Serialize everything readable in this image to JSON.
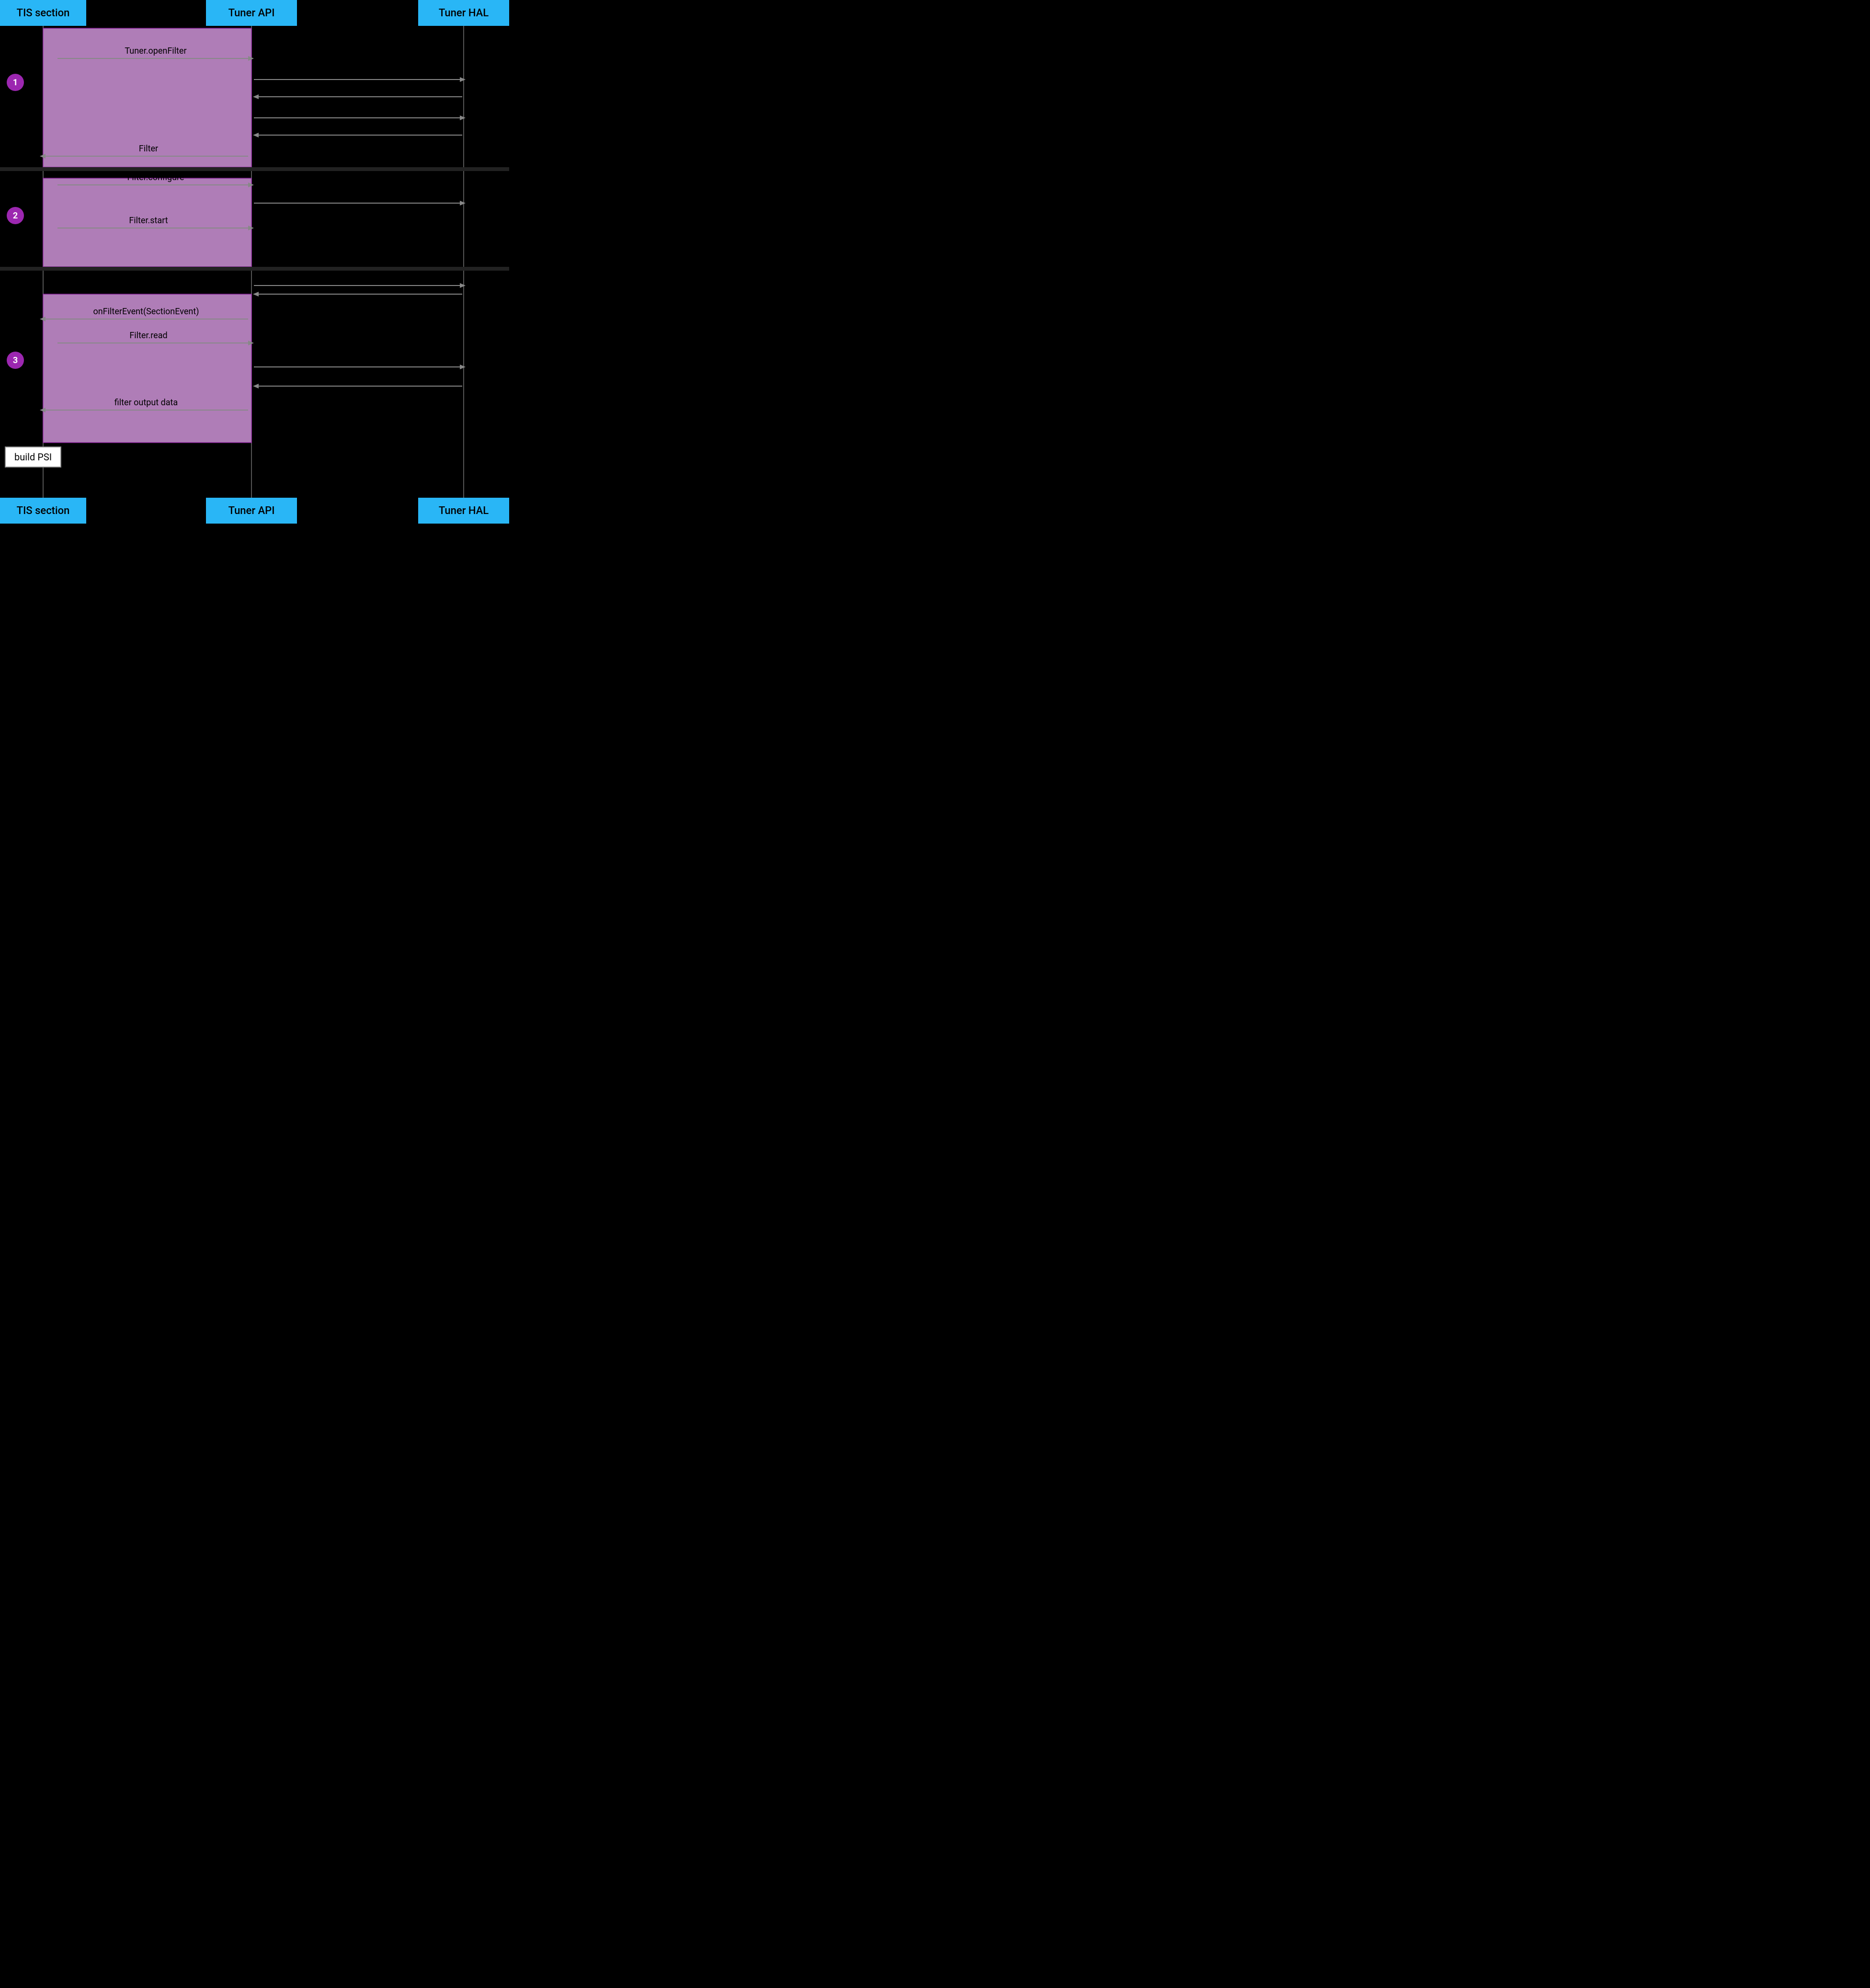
{
  "header": {
    "tis_label": "TIS section",
    "tuner_api_label": "Tuner API",
    "tuner_hal_label": "Tuner HAL"
  },
  "footer": {
    "tis_label": "TIS section",
    "tuner_api_label": "Tuner API",
    "tuner_hal_label": "Tuner HAL"
  },
  "steps": [
    {
      "number": "1"
    },
    {
      "number": "2"
    },
    {
      "number": "3"
    }
  ],
  "messages": [
    {
      "id": "tuner_open_filter",
      "label": "Tuner.openFilter"
    },
    {
      "id": "filter",
      "label": "Filter"
    },
    {
      "id": "filter_configure",
      "label": "Filter.configure"
    },
    {
      "id": "filter_start",
      "label": "Filter.start"
    },
    {
      "id": "on_filter_event",
      "label": "onFilterEvent(SectionEvent)"
    },
    {
      "id": "filter_read",
      "label": "Filter.read"
    },
    {
      "id": "filter_output_data",
      "label": "filter output data"
    }
  ],
  "build_psi": {
    "label": "build PSI"
  },
  "colors": {
    "header_bg": "#29b6f6",
    "activation_bg": "#ce93d8",
    "activation_border": "#9c27b0",
    "step_bg": "#9c27b0",
    "arrow_color": "#888888",
    "background": "#000000"
  }
}
